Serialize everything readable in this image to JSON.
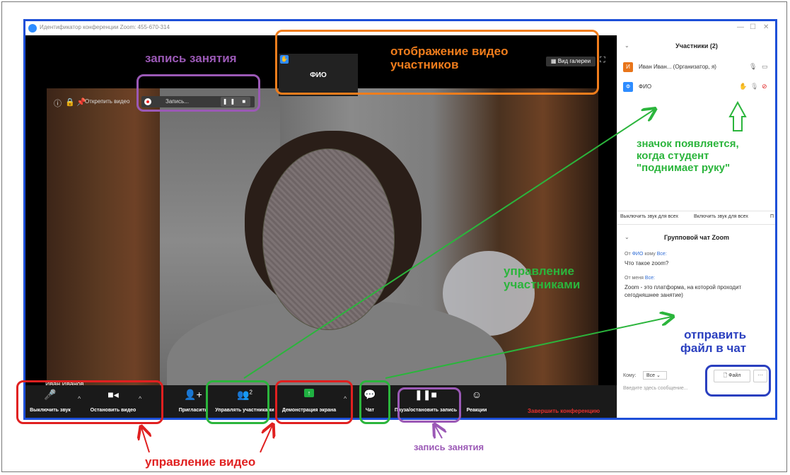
{
  "window": {
    "title": "Идентификатор конференции Zoom: 455-670-314",
    "controls": [
      "—",
      "☐",
      "✕"
    ]
  },
  "video": {
    "speaker_name": "Иван Иванов",
    "thumb_name": "ФИО",
    "gallery_label": "Вид галереи",
    "unpin_label": "Открепить видео",
    "recording_label": "Запись...",
    "recording_controls": "❚❚ ■"
  },
  "toolbar": {
    "mute": "Выключить звук",
    "stop_video": "Остановить видео",
    "invite": "Пригласить",
    "participants": "Управлять участниками",
    "participants_count": "2",
    "share": "Демонстрация экрана",
    "chat": "Чат",
    "record": "Пауза/остановить запись",
    "reactions": "Реакции",
    "end": "Завершить конференцию"
  },
  "participants_panel": {
    "title": "Участники (2)",
    "items": [
      {
        "avatar": "И",
        "name": "Иван Иван... (Организатор, я)",
        "color": "#e8751a"
      },
      {
        "avatar": "Ф",
        "name": "ФИО",
        "color": "#2d8cff"
      }
    ],
    "mute_all": "Выключить звук для всех",
    "unmute_all": "Включить звук для всех",
    "more": "П"
  },
  "chat_panel": {
    "title": "Групповой чат Zoom",
    "messages": [
      {
        "from_prefix": "От",
        "from": "ФИО",
        "to_prefix": "кому",
        "to": "Все:",
        "text": "Что такое zoom?"
      },
      {
        "from_prefix": "От меня",
        "to": "Все:",
        "text": "Zoom - это платформа, на которой проходит сегодняшнее занятие)"
      }
    ],
    "to_label": "Кому:",
    "to_value": "Все",
    "file_label": "Файл",
    "more": "···",
    "input_placeholder": "Введите здесь сообщение..."
  },
  "annotations": {
    "record_top": "запись занятия",
    "video_participants": "отображение видео\nучастников",
    "raise_hand": "значок появляется,\nкогда студент\n\"поднимает руку\"",
    "manage_participants": "управление\nучастниками",
    "send_file": "отправить\nфайл в чат",
    "video_control": "управление видео",
    "record_bottom": "запись занятия"
  },
  "colors": {
    "purple": "#9b59b6",
    "orange": "#f07d1c",
    "green": "#2bb53c",
    "red": "#e02020",
    "blue": "#2a3fbf",
    "window_border": "#1d4fd8"
  }
}
